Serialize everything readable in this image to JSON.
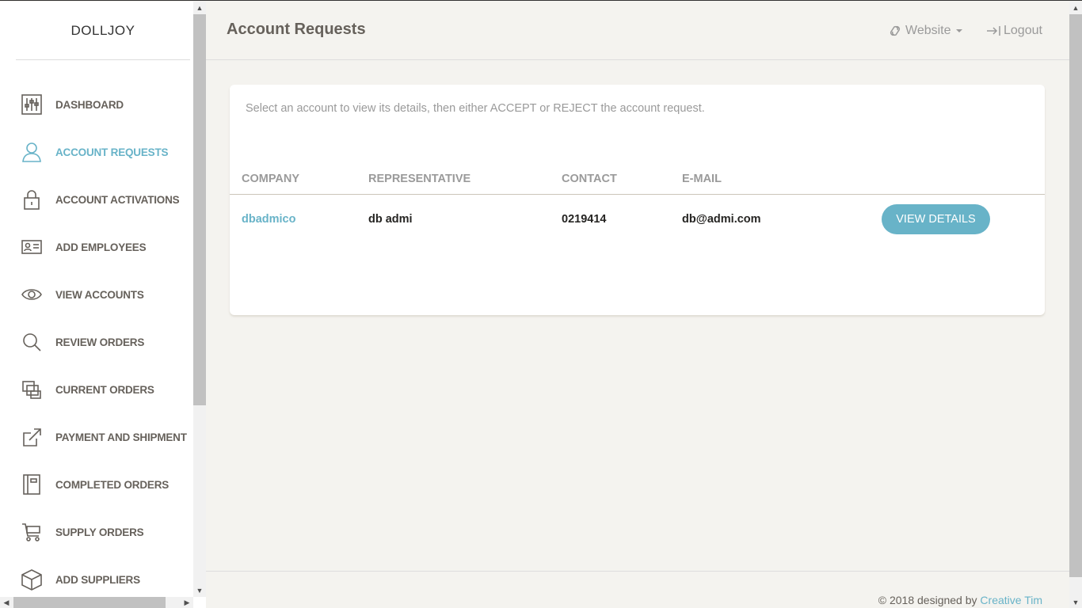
{
  "brand": "DOLLJOY",
  "sidebar": {
    "items": [
      {
        "label": "DASHBOARD",
        "icon": "sliders-icon"
      },
      {
        "label": "ACCOUNT REQUESTS",
        "icon": "user-icon",
        "active": true
      },
      {
        "label": "ACCOUNT ACTIVATIONS",
        "icon": "lock-icon"
      },
      {
        "label": "ADD EMPLOYEES",
        "icon": "id-card-icon"
      },
      {
        "label": "VIEW ACCOUNTS",
        "icon": "eye-icon"
      },
      {
        "label": "REVIEW ORDERS",
        "icon": "search-icon"
      },
      {
        "label": "CURRENT ORDERS",
        "icon": "stacked-windows-icon"
      },
      {
        "label": "PAYMENT AND SHIPMENT",
        "icon": "external-link-icon"
      },
      {
        "label": "COMPLETED ORDERS",
        "icon": "notebook-icon"
      },
      {
        "label": "SUPPLY ORDERS",
        "icon": "cart-icon"
      },
      {
        "label": "ADD SUPPLIERS",
        "icon": "box-icon"
      }
    ]
  },
  "header": {
    "title": "Account Requests",
    "website_label": "Website",
    "logout_label": "Logout"
  },
  "card": {
    "description": "Select an account to view its details, then either ACCEPT or REJECT the account request."
  },
  "table": {
    "columns": [
      "COMPANY",
      "REPRESENTATIVE",
      "CONTACT",
      "E-MAIL",
      ""
    ],
    "rows": [
      {
        "company": "dbadmico",
        "representative": "db admi",
        "contact": "0219414",
        "email": "db@admi.com",
        "action": "VIEW DETAILS"
      }
    ]
  },
  "footer": {
    "prefix": "© 2018 designed by ",
    "link": "Creative Tim"
  },
  "colors": {
    "accent": "#68b3c8",
    "background": "#f4f3ef",
    "text_muted": "#9a9a9a"
  }
}
